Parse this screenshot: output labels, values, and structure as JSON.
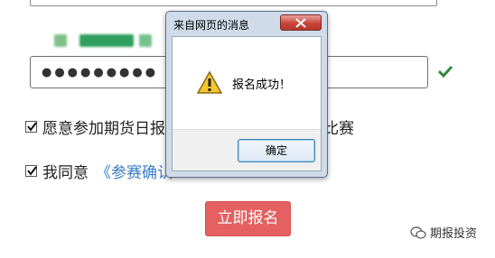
{
  "form": {
    "password_dots": "●●●●●●●●●",
    "agree_daily_prefix": "愿意参加期货日报",
    "agree_daily_suffix": "组比赛",
    "agree_terms_prefix": "我同意",
    "agree_terms_link": "《参赛确认",
    "submit_label": "立即报名"
  },
  "dialog": {
    "title": "来自网页的消息",
    "message": "报名成功！",
    "ok_label": "确定"
  },
  "watermark": {
    "text": "期报投资"
  },
  "colors": {
    "submit_bg": "#e56060",
    "link": "#3a7cc2",
    "check_ok": "#2e8a3a"
  }
}
